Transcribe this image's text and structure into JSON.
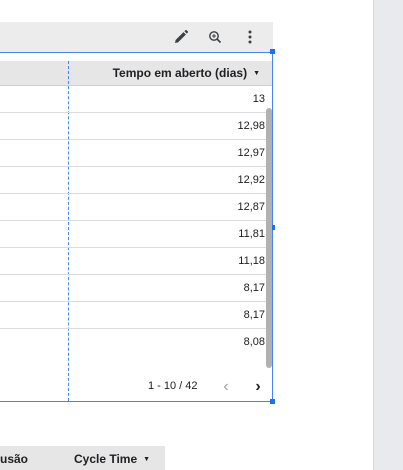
{
  "toolbar": {
    "icons": [
      "pencil-icon",
      "zoom-icon",
      "more-vert-icon"
    ]
  },
  "table": {
    "column_header": "Tempo em aberto (dias)",
    "values": [
      "13",
      "12,98",
      "12,97",
      "12,92",
      "12,87",
      "11,81",
      "11,18",
      "8,17",
      "8,17",
      "8,08"
    ],
    "pagination": "1 - 10 / 42",
    "prev_label": "‹",
    "next_label": "›"
  },
  "table2": {
    "col1_header": "usão",
    "col2_header": "Cycle Time"
  },
  "colors": {
    "selection": "#4285f4",
    "header_bg": "#e6e6e6",
    "toolbar_bg": "#ececec"
  }
}
